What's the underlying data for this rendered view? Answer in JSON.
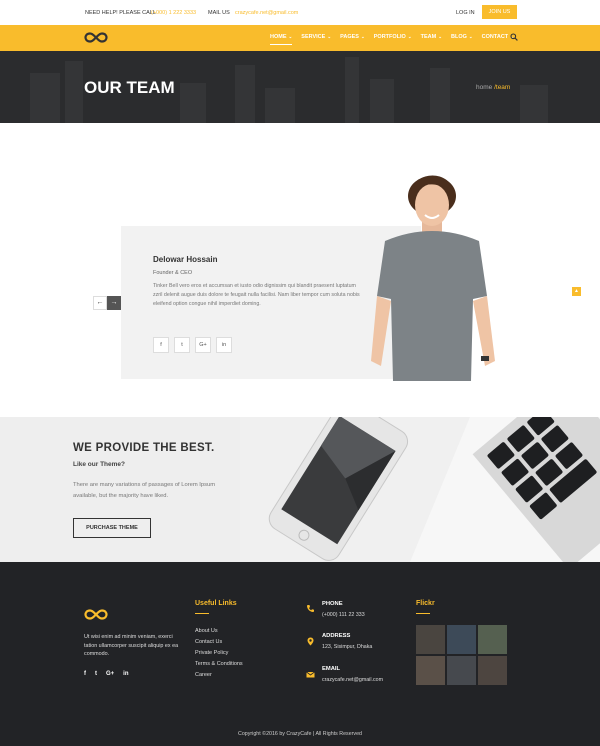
{
  "topbar": {
    "help_label": "NEED HELP! PLEASE CALL",
    "phone": "(+000) 1 222 3333",
    "mail_label": "MAIL US",
    "mail": "crazycafe.net@gmail.com",
    "login": "LOG IN",
    "join": "JOIN US"
  },
  "nav": {
    "items": [
      {
        "label": "HOME"
      },
      {
        "label": "SERVICE"
      },
      {
        "label": "PAGES"
      },
      {
        "label": "PORTFOLIO"
      },
      {
        "label": "TEAM"
      },
      {
        "label": "BLOG"
      },
      {
        "label": "CONTACT"
      }
    ],
    "logo_icon": "infinity-logo-icon",
    "search_icon": "search-icon"
  },
  "banner": {
    "title": "OUR TEAM",
    "crumb_home": "home",
    "crumb_sep": "/",
    "crumb_current": "team"
  },
  "member": {
    "name": "Delowar Hossain",
    "role": "Founder & CEO",
    "bio": "Tinker Bell vero eros et accumsan et iusto odio dignissim qui blandit praesent luptatum zzril delenit augue duis dolore te feugait nulla facilisi. Nam liber tempor cum soluta nobis eleifend option congue nihil imperdiet doming.",
    "socials": [
      "f",
      "t",
      "G+",
      "in"
    ]
  },
  "provide": {
    "heading": "WE PROVIDE THE BEST.",
    "sub": "Like our Theme?",
    "text": "There are many variations of passages of Lorem Ipsum available, but the majority have liked.",
    "button": "PURCHASE THEME"
  },
  "footer": {
    "about": "Ut wisi enim ad minim veniam, exerci tation ullamcorper suscipit aliquip ex ea commodo.",
    "socials": [
      "f",
      "t",
      "G+",
      "in"
    ],
    "links_title": "Useful Links",
    "links": [
      "About Us",
      "Contact Us",
      "Private Policy",
      "Terms & Conditions",
      "Career"
    ],
    "phone_label": "PHONE",
    "phone_value": "(+000) 111 22 333",
    "address_label": "ADDRESS",
    "address_value": "123, Sisimpur, Dhaka",
    "email_label": "EMAIL",
    "email_value": "crazycafe.net@gmail.com",
    "flickr_title": "Flickr",
    "copyright": "Copyright ©2016 by CrazyCafe  |  All Rights Reserved"
  },
  "colors": {
    "accent": "#f9bc2c",
    "dark": "#222326",
    "banner": "#2b2c2e"
  }
}
